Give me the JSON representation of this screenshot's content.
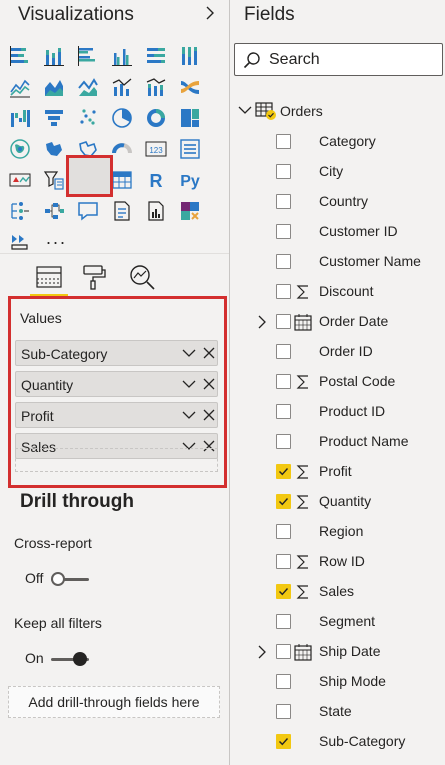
{
  "visualizations": {
    "title": "Visualizations",
    "more_label": "...",
    "icons": [
      "stacked-bar-icon",
      "stacked-column-icon",
      "clustered-bar-icon",
      "clustered-column-icon",
      "100-stacked-bar-icon",
      "100-stacked-column-icon",
      "line-chart-icon",
      "area-chart-icon",
      "stacked-area-icon",
      "line-column-icon",
      "line-stacked-column-icon",
      "ribbon-chart-icon",
      "waterfall-icon",
      "funnel-icon",
      "scatter-icon",
      "pie-chart-icon",
      "donut-chart-icon",
      "treemap-icon",
      "map-icon",
      "filled-map-icon",
      "shape-map-icon",
      "gauge-icon",
      "card-icon",
      "multi-row-card-icon",
      "kpi-icon",
      "slicer-icon",
      "table-icon",
      "matrix-icon",
      "r-visual-icon",
      "python-visual-icon",
      "key-influencers-icon",
      "decomposition-tree-icon",
      "qa-icon",
      "smart-narrative-icon",
      "paginated-report-icon",
      "power-apps-icon",
      "power-automate-icon"
    ],
    "r_label": "R",
    "py_label": "Py",
    "card_label": "123",
    "tabs": [
      "fields-tab-icon",
      "format-tab-icon",
      "analytics-tab-icon"
    ],
    "values": {
      "label": "Values",
      "items": [
        "Sub-Category",
        "Quantity",
        "Profit",
        "Sales"
      ]
    },
    "drill_through": {
      "title": "Drill through",
      "cross_report_label": "Cross-report",
      "cross_report_state": "Off",
      "keep_filters_label": "Keep all filters",
      "keep_filters_state": "On",
      "add_fields_label": "Add drill-through fields here"
    }
  },
  "fields": {
    "title": "Fields",
    "search_placeholder": "Search",
    "table_name": "Orders",
    "items": [
      {
        "name": "Category",
        "checked": false,
        "type": "text"
      },
      {
        "name": "City",
        "checked": false,
        "type": "text"
      },
      {
        "name": "Country",
        "checked": false,
        "type": "text"
      },
      {
        "name": "Customer ID",
        "checked": false,
        "type": "text"
      },
      {
        "name": "Customer Name",
        "checked": false,
        "type": "text"
      },
      {
        "name": "Discount",
        "checked": false,
        "type": "sum"
      },
      {
        "name": "Order Date",
        "checked": false,
        "type": "date"
      },
      {
        "name": "Order ID",
        "checked": false,
        "type": "text"
      },
      {
        "name": "Postal Code",
        "checked": false,
        "type": "sum"
      },
      {
        "name": "Product ID",
        "checked": false,
        "type": "text"
      },
      {
        "name": "Product Name",
        "checked": false,
        "type": "text"
      },
      {
        "name": "Profit",
        "checked": true,
        "type": "sum"
      },
      {
        "name": "Quantity",
        "checked": true,
        "type": "sum"
      },
      {
        "name": "Region",
        "checked": false,
        "type": "text"
      },
      {
        "name": "Row ID",
        "checked": false,
        "type": "sum"
      },
      {
        "name": "Sales",
        "checked": true,
        "type": "sum"
      },
      {
        "name": "Segment",
        "checked": false,
        "type": "text"
      },
      {
        "name": "Ship Date",
        "checked": false,
        "type": "date"
      },
      {
        "name": "Ship Mode",
        "checked": false,
        "type": "text"
      },
      {
        "name": "State",
        "checked": false,
        "type": "text"
      },
      {
        "name": "Sub-Category",
        "checked": true,
        "type": "text"
      }
    ]
  },
  "colors": {
    "highlight_red": "#d32f2f",
    "check_yellow": "#f2c811",
    "icon_blue": "#2b78c5",
    "icon_teal": "#3aa8a0"
  }
}
